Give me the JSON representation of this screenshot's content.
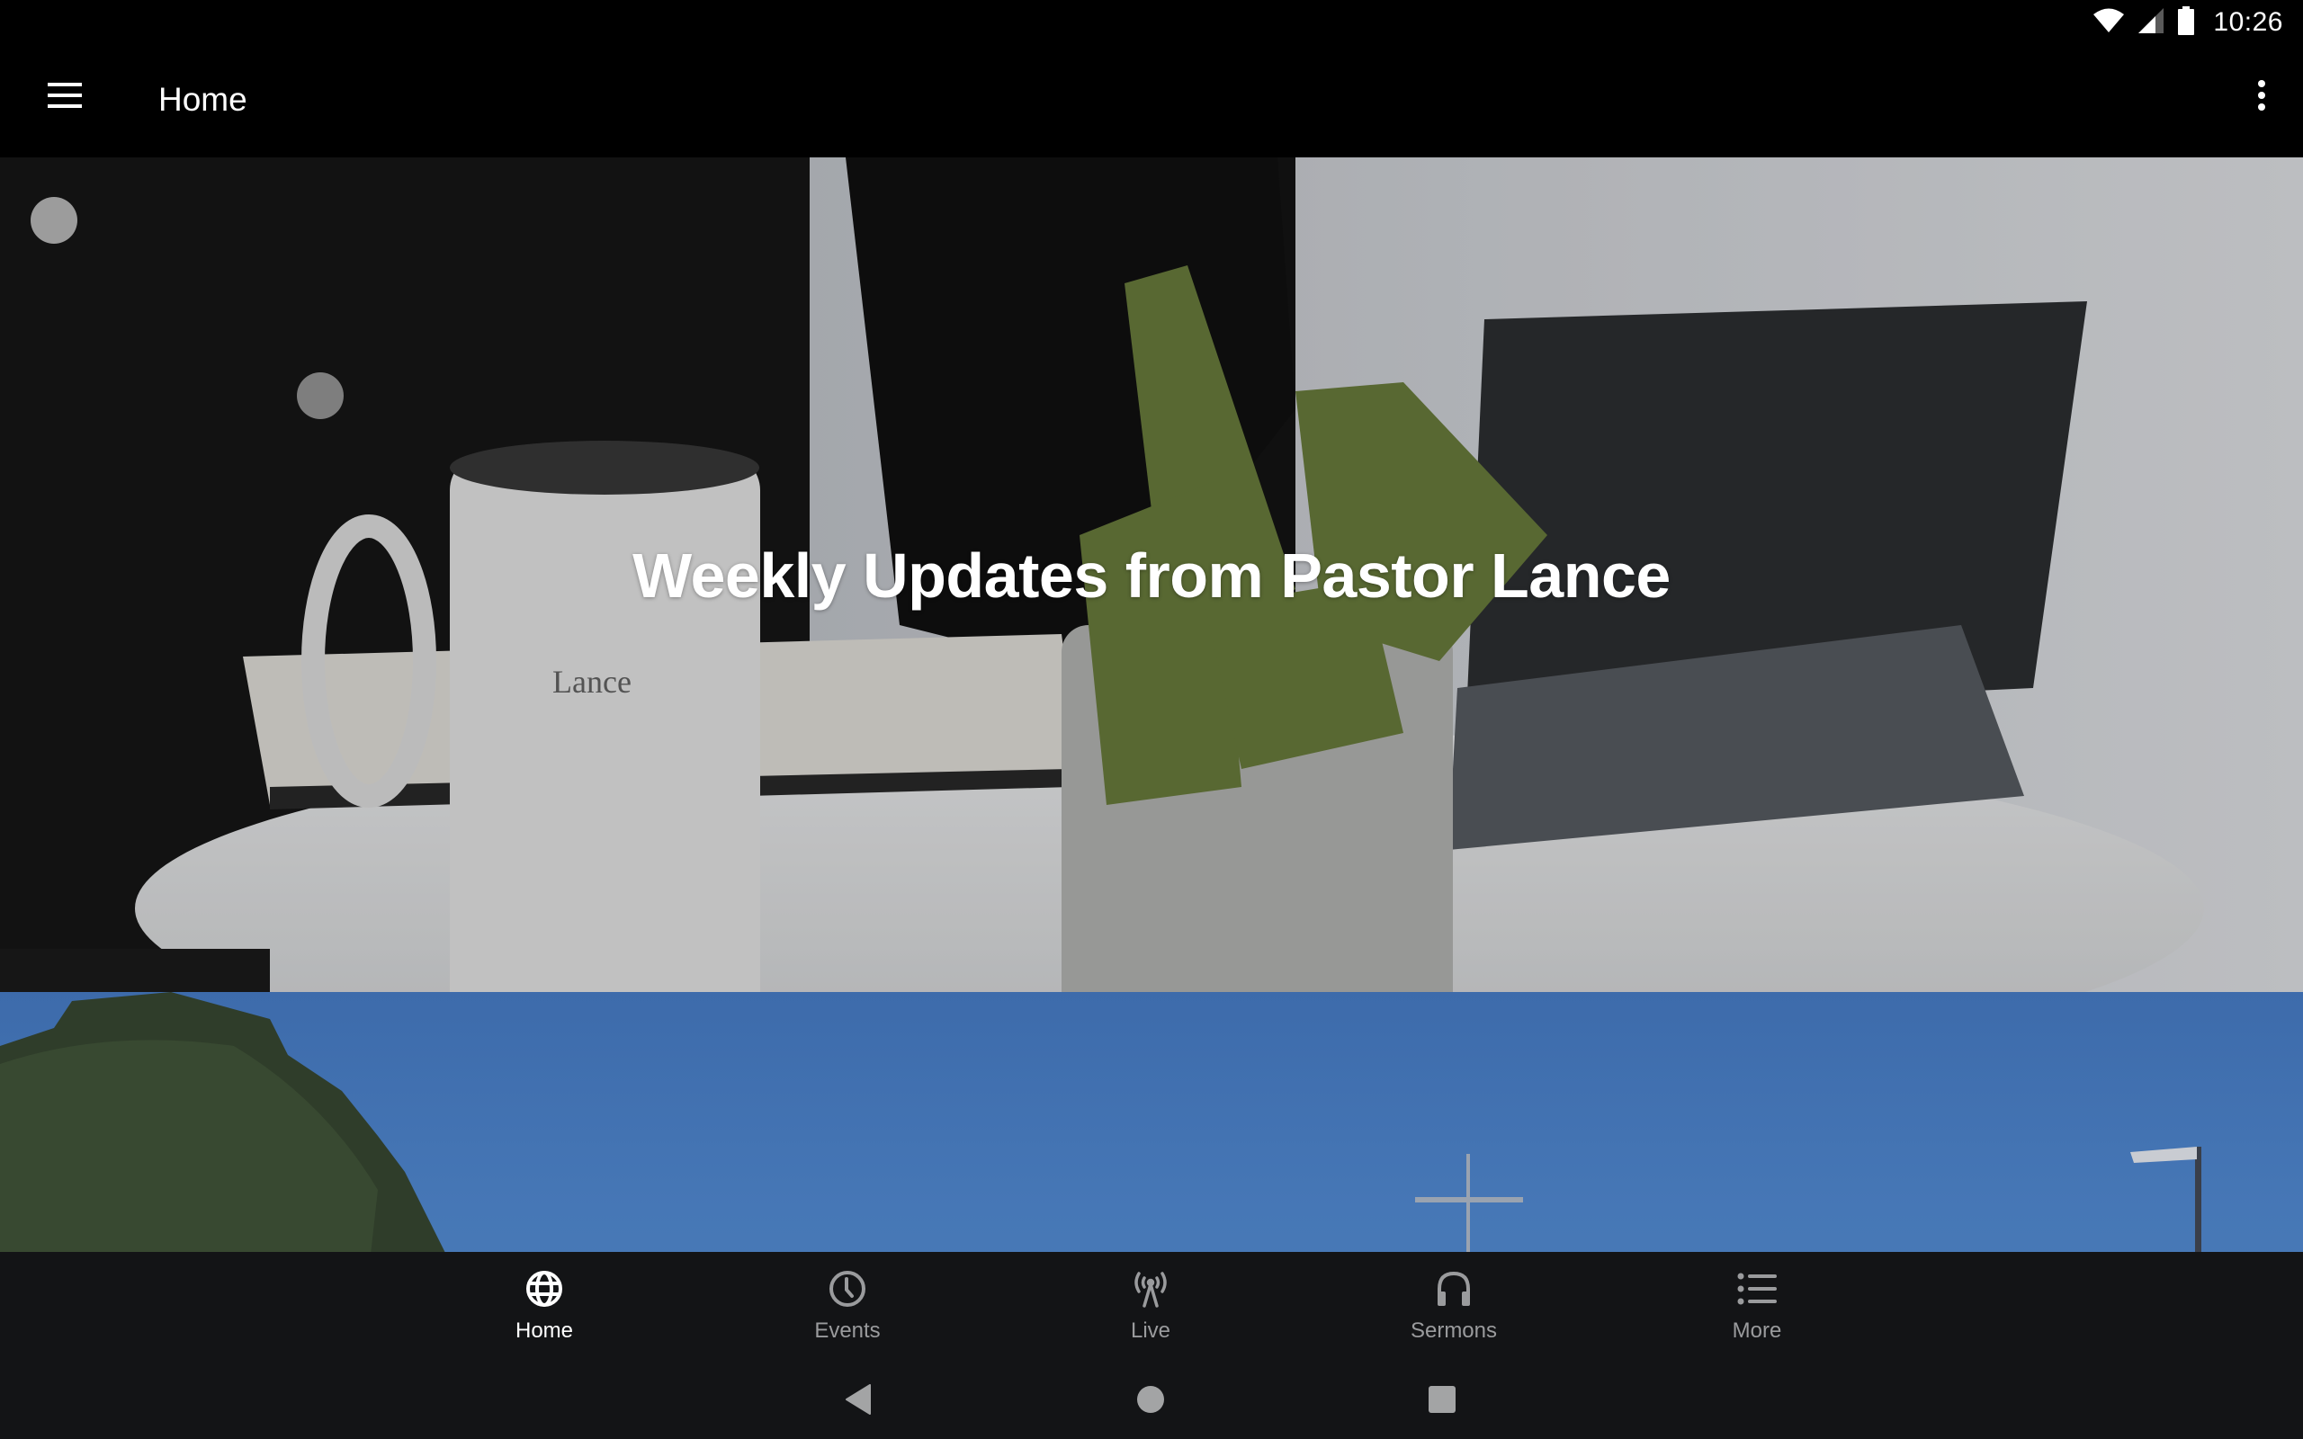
{
  "status_bar": {
    "time": "10:26",
    "icons": [
      "wifi-icon",
      "signal-icon",
      "battery-icon"
    ]
  },
  "app_bar": {
    "title": "Home",
    "menu_icon": "hamburger-menu-icon",
    "overflow_icon": "more-vert-icon"
  },
  "feed": {
    "cards": [
      {
        "title": "Weekly Updates from Pastor Lance",
        "image": "coffee-mug-plant-tablet-photo",
        "mug_text": "Lance"
      },
      {
        "title": "",
        "image": "tree-sky-cross-photo"
      }
    ]
  },
  "bottom_nav": {
    "active_index": 0,
    "items": [
      {
        "label": "Home",
        "icon": "globe-icon"
      },
      {
        "label": "Events",
        "icon": "clock-icon"
      },
      {
        "label": "Live",
        "icon": "broadcast-tower-icon"
      },
      {
        "label": "Sermons",
        "icon": "headphones-icon"
      },
      {
        "label": "More",
        "icon": "list-icon"
      }
    ]
  },
  "colors": {
    "app_bar_bg": "#000000",
    "bottom_nav_bg": "#131416",
    "nav_active": "#ffffff",
    "nav_inactive": "#9a9b9d"
  }
}
